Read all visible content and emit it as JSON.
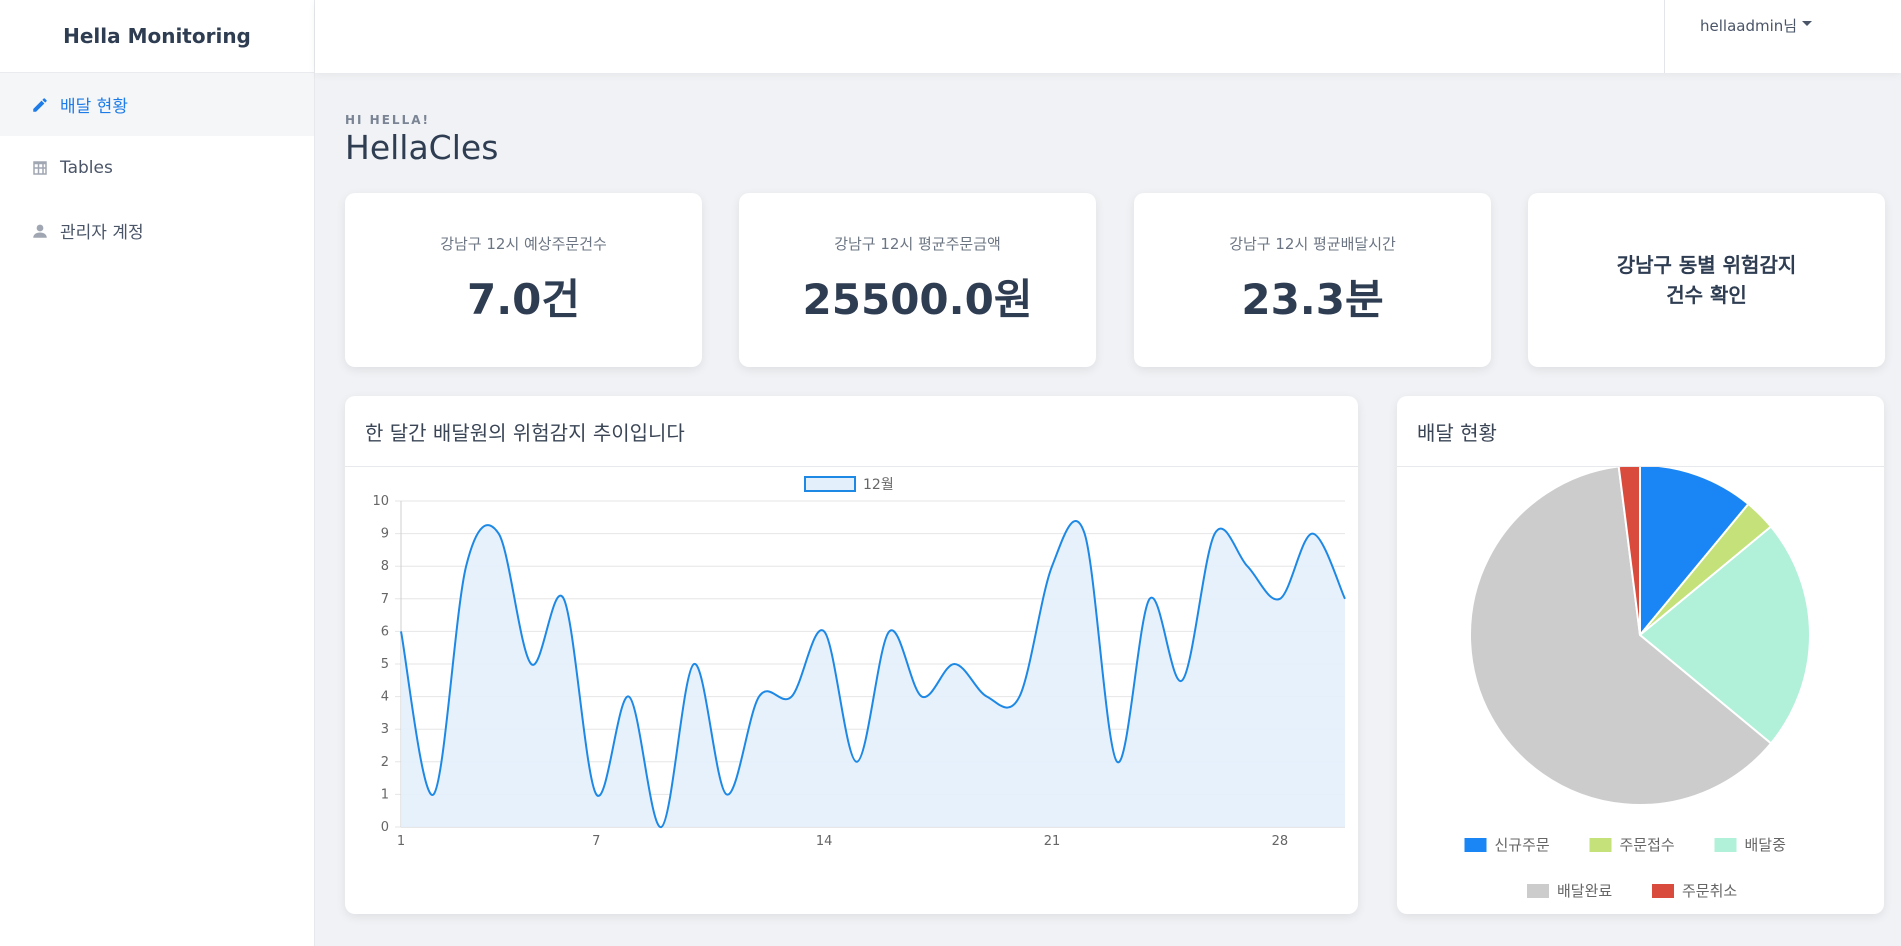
{
  "app": {
    "brand": "Hella Monitoring"
  },
  "sidebar": {
    "items": [
      {
        "label": "배달 현황",
        "icon": "pencil-icon",
        "active": true
      },
      {
        "label": "Tables",
        "icon": "table-icon",
        "active": false
      },
      {
        "label": "관리자 계정",
        "icon": "user-icon",
        "active": false
      }
    ]
  },
  "header": {
    "user": "hellaadmin님"
  },
  "page": {
    "subtitle": "HI HELLA!",
    "title": "HellaCles"
  },
  "stats": [
    {
      "label": "강남구 12시 예상주문건수",
      "value": "7.0건"
    },
    {
      "label": "강남구 12시 평균주문금액",
      "value": "25500.0원"
    },
    {
      "label": "강남구 12시 평균배달시간",
      "value": "23.3분"
    }
  ],
  "risk_link": {
    "line1": "강남구 동별 위험감지",
    "line2": "건수 확인"
  },
  "line_panel": {
    "title": "한 달간 배달원의 위험감지 추이입니다"
  },
  "pie_panel": {
    "title": "배달 현황"
  },
  "colors": {
    "accent": "#1e7ce8",
    "line": "#1e88e5",
    "fill": "#e3f0fc"
  },
  "chart_data": [
    {
      "type": "area",
      "legend": [
        "12월"
      ],
      "x": [
        1,
        2,
        3,
        4,
        5,
        6,
        7,
        8,
        9,
        10,
        11,
        12,
        13,
        14,
        15,
        16,
        17,
        18,
        19,
        20,
        21,
        22,
        23,
        24,
        25,
        26,
        27,
        28,
        29
      ],
      "x_ticks": [
        1,
        7,
        14,
        21,
        28
      ],
      "series": [
        {
          "name": "12월",
          "values": [
            6,
            1,
            8,
            9,
            5,
            7,
            1,
            4,
            0,
            5,
            1,
            4,
            4,
            6,
            2,
            6,
            4,
            5,
            4,
            4,
            8,
            9,
            2,
            7,
            4.5,
            9,
            8,
            7,
            9,
            7
          ]
        }
      ],
      "ylim": [
        0,
        10
      ],
      "y_ticks": [
        0,
        1,
        2,
        3,
        4,
        5,
        6,
        7,
        8,
        9,
        10
      ],
      "grid": true,
      "legend_position": "top"
    },
    {
      "type": "pie",
      "labels": [
        "신규주문",
        "주문접수",
        "배달중",
        "배달완료",
        "주문취소"
      ],
      "values": [
        11,
        3,
        22,
        62,
        2
      ],
      "colors": [
        "#1a86f5",
        "#c5e17a",
        "#b1f0d9",
        "#cccccc",
        "#d94c3d"
      ],
      "legend_position": "bottom"
    }
  ]
}
